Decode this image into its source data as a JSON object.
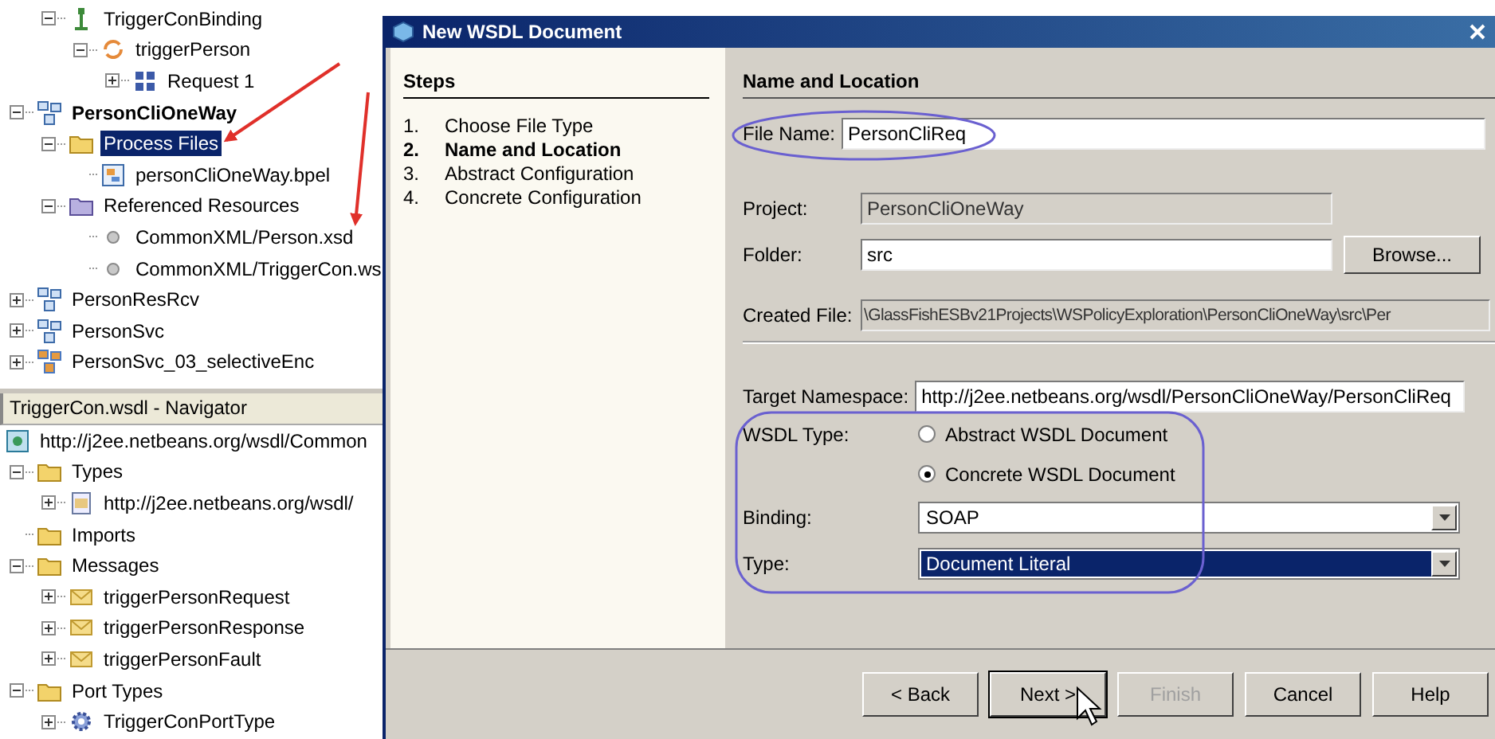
{
  "project_tree": {
    "cut_branch": [
      {
        "label": "TriggerConBinding",
        "kind": "binding",
        "expanded": true,
        "selected": false,
        "children": [
          {
            "label": "triggerPerson",
            "kind": "operation",
            "expanded": true,
            "selected": false,
            "children": [
              {
                "label": "Request 1",
                "kind": "soap",
                "expanded": false,
                "selected": false
              }
            ]
          }
        ]
      }
    ],
    "items": [
      {
        "label": "PersonCliOneWay",
        "kind": "project",
        "main": true,
        "expanded": true,
        "selected": false,
        "children": [
          {
            "label": "Process Files",
            "kind": "folder",
            "expanded": true,
            "selected": true,
            "children": [
              {
                "label": "personCliOneWay.bpel",
                "kind": "bpel",
                "selected": false
              }
            ]
          },
          {
            "label": "Referenced Resources",
            "kind": "resources",
            "expanded": true,
            "selected": false,
            "children": [
              {
                "label": "CommonXML/Person.xsd",
                "kind": "dot",
                "selected": false
              },
              {
                "label": "CommonXML/TriggerCon.ws",
                "kind": "dot",
                "selected": false
              }
            ]
          }
        ]
      },
      {
        "label": "PersonResRcv",
        "kind": "project",
        "main": false,
        "expanded": false,
        "selected": false
      },
      {
        "label": "PersonSvc",
        "kind": "project",
        "main": false,
        "expanded": false,
        "selected": false
      },
      {
        "label": "PersonSvc_03_selectiveEnc",
        "kind": "composite",
        "main": false,
        "expanded": false,
        "selected": false
      }
    ]
  },
  "navigator": {
    "title": "TriggerCon.wsdl - Navigator",
    "root": {
      "label": "http://j2ee.netbeans.org/wsdl/Common",
      "kind": "wsdl"
    },
    "items": [
      {
        "label": "Types",
        "kind": "folder",
        "expanded": true,
        "selected": false,
        "children": [
          {
            "label": "http://j2ee.netbeans.org/wsdl/",
            "kind": "schema",
            "expanded": false,
            "selected": false
          }
        ]
      },
      {
        "label": "Imports",
        "kind": "folder",
        "selected": false
      },
      {
        "label": "Messages",
        "kind": "folder",
        "expanded": true,
        "selected": false,
        "children": [
          {
            "label": "triggerPersonRequest",
            "kind": "message",
            "expanded": false,
            "selected": false
          },
          {
            "label": "triggerPersonResponse",
            "kind": "message",
            "expanded": false,
            "selected": false
          },
          {
            "label": "triggerPersonFault",
            "kind": "message",
            "expanded": false,
            "selected": false
          }
        ]
      },
      {
        "label": "Port Types",
        "kind": "folder",
        "expanded": true,
        "selected": false,
        "children": [
          {
            "label": "TriggerConPortType",
            "kind": "gear",
            "expanded": false,
            "selected": false
          }
        ]
      }
    ]
  },
  "dialog": {
    "title": "New WSDL Document",
    "steps_heading": "Steps",
    "steps": [
      {
        "number": "1.",
        "label": "Choose File Type",
        "selected": false
      },
      {
        "number": "2.",
        "label": "Name and Location",
        "selected": true
      },
      {
        "number": "3.",
        "label": "Abstract Configuration",
        "selected": false
      },
      {
        "number": "4.",
        "label": "Concrete Configuration",
        "selected": false
      }
    ],
    "section_title": "Name and Location",
    "file_name": {
      "label": "File Name:",
      "value": "PersonCliReq",
      "disabled": false
    },
    "project": {
      "label": "Project:",
      "value": "PersonCliOneWay",
      "disabled": true
    },
    "folder": {
      "label": "Folder:",
      "value": "src",
      "disabled": false,
      "button": "Browse..."
    },
    "created_file": {
      "label": "Created File:",
      "value": "\\GlassFishESBv21Projects\\WSPolicyExploration\\PersonCliOneWay\\src\\Per",
      "disabled": true
    },
    "target_namespace": {
      "label": "Target Namespace:",
      "value": "http://j2ee.netbeans.org/wsdl/PersonCliOneWay/PersonCliReq",
      "disabled": false
    },
    "wsdl_type": {
      "label": "WSDL Type:",
      "options": [
        {
          "label": "Abstract WSDL Document",
          "selected": false
        },
        {
          "label": "Concrete WSDL Document",
          "selected": true
        }
      ]
    },
    "binding": {
      "label": "Binding:",
      "value": "SOAP",
      "focused": false
    },
    "type": {
      "label": "Type:",
      "value": "Document Literal",
      "focused": true
    },
    "buttons": [
      {
        "label": "< Back",
        "disabled": false,
        "focused": false
      },
      {
        "label": "Next >",
        "disabled": false,
        "focused": true
      },
      {
        "label": "Finish",
        "disabled": true,
        "focused": false
      },
      {
        "label": "Cancel",
        "disabled": false,
        "focused": false
      },
      {
        "label": "Help",
        "disabled": false,
        "focused": false
      }
    ]
  }
}
